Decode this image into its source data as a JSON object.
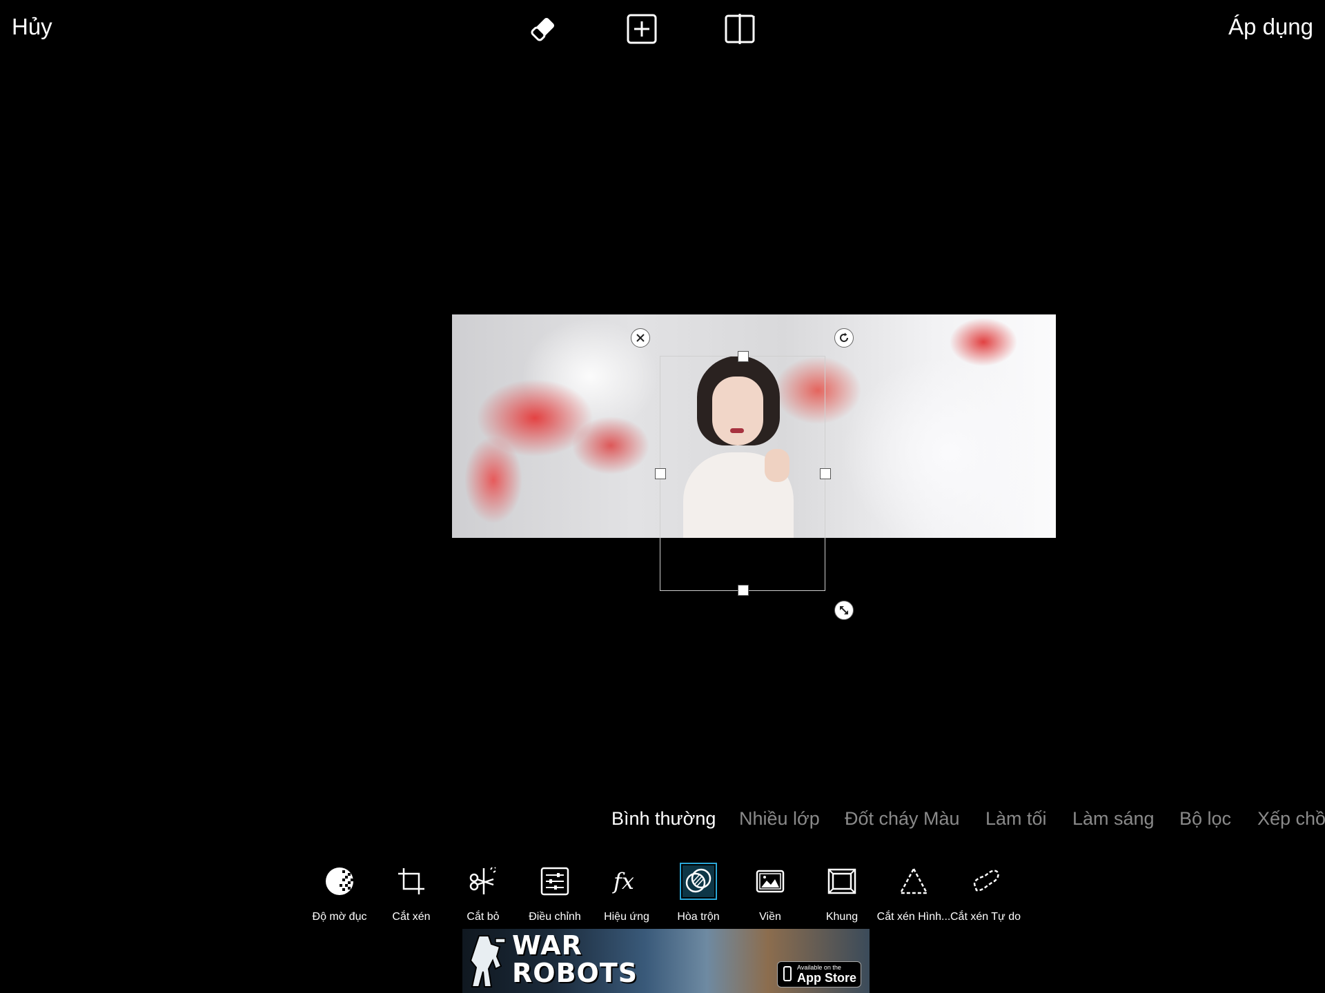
{
  "topbar": {
    "cancel_label": "Hủy",
    "apply_label": "Áp dụng",
    "icons": [
      "eraser-icon",
      "add-layer-icon",
      "flip-icon"
    ]
  },
  "blend_modes": {
    "items": [
      "Bình thường",
      "Nhiều lớp",
      "Đốt cháy Màu",
      "Làm tối",
      "Làm sáng",
      "Bộ lọc",
      "Xếp chồ"
    ],
    "selected": "Bình thường"
  },
  "tools": {
    "items": [
      {
        "label": "Độ mờ đục",
        "icon": "opacity-icon"
      },
      {
        "label": "Cắt xén",
        "icon": "crop-icon"
      },
      {
        "label": "Cắt bỏ",
        "icon": "cutout-icon"
      },
      {
        "label": "Điều chỉnh",
        "icon": "adjust-icon"
      },
      {
        "label": "Hiệu ứng",
        "icon": "effects-icon"
      },
      {
        "label": "Hòa trộn",
        "icon": "blend-icon"
      },
      {
        "label": "Viền",
        "icon": "border-icon"
      },
      {
        "label": "Khung",
        "icon": "frame-icon"
      },
      {
        "label": "Cắt xén Hình...",
        "icon": "shape-crop-icon"
      },
      {
        "label": "Cắt xén Tự do",
        "icon": "free-crop-icon"
      }
    ],
    "active": "Hòa trộn"
  },
  "ad": {
    "title_line1": "WAR",
    "title_line2": "ROBOTS",
    "store_small": "Available on the",
    "store_big": "App Store"
  },
  "colors": {
    "background": "#000000",
    "inactive_text": "#8a8a8a",
    "active_tool_accent": "#2aa7d8"
  }
}
